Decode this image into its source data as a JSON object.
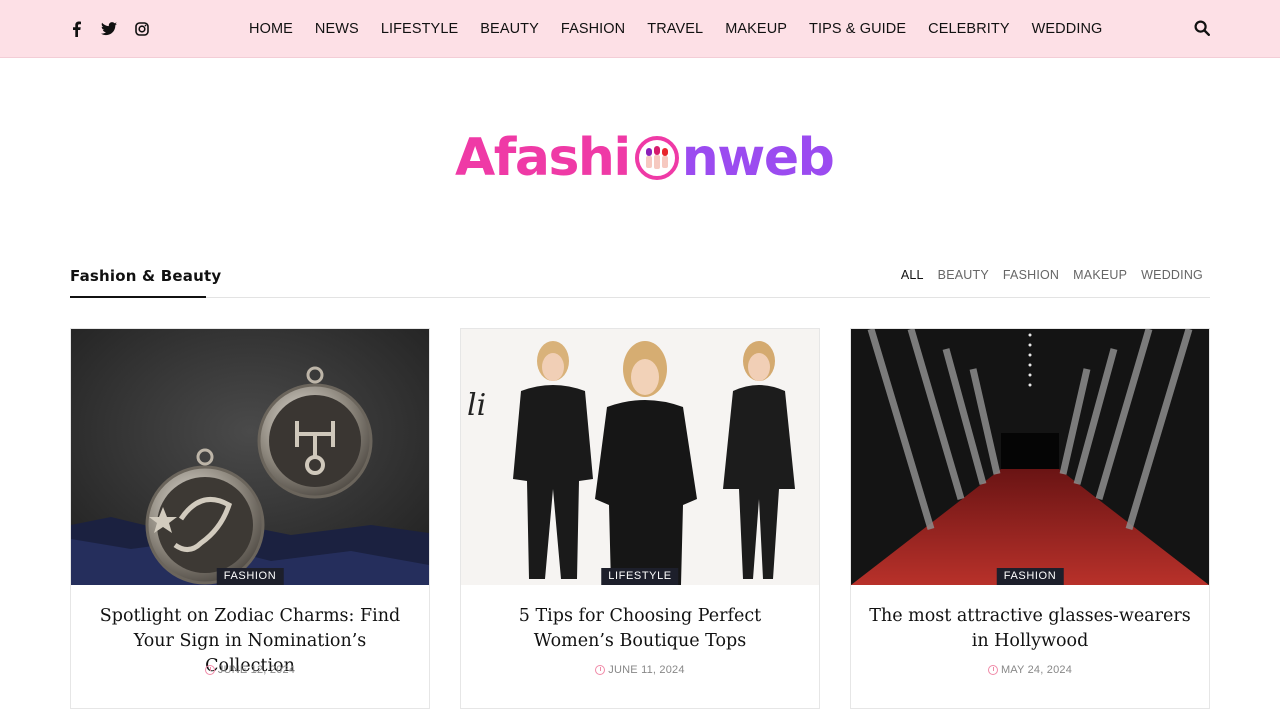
{
  "social": [
    {
      "name": "facebook-icon"
    },
    {
      "name": "twitter-icon"
    },
    {
      "name": "instagram-icon"
    }
  ],
  "nav": [
    "HOME",
    "NEWS",
    "LIFESTYLE",
    "BEAUTY",
    "FASHION",
    "TRAVEL",
    "MAKEUP",
    "TIPS & GUIDE",
    "CELEBRITY",
    "WEDDING"
  ],
  "logo": {
    "part1": "Afashi",
    "part2": "nweb",
    "colors": {
      "pink": "#ef3aa6",
      "purple": "#9b4bf0"
    }
  },
  "section": {
    "title": "Fashion & Beauty",
    "filters": [
      "ALL",
      "BEAUTY",
      "FASHION",
      "MAKEUP",
      "WEDDING"
    ],
    "active_filter": "ALL"
  },
  "cards": [
    {
      "category": "FASHION",
      "title": "Spotlight on Zodiac Charms: Find Your Sign in Nomination’s Collection",
      "date": "JUNE 12, 2024",
      "image": "zodiac-charms-image"
    },
    {
      "category": "LIFESTYLE",
      "title": "5 Tips for Choosing Perfect Women’s Boutique Tops",
      "date": "JUNE 11, 2024",
      "image": "boutique-tops-image"
    },
    {
      "category": "FASHION",
      "title": "The most attractive glasses-wearers in Hollywood",
      "date": "MAY 24, 2024",
      "image": "red-carpet-image"
    }
  ],
  "colors": {
    "topbar": "#fde0e6",
    "badge": "#1d1f2b",
    "date_icon": "#f08aa8"
  }
}
